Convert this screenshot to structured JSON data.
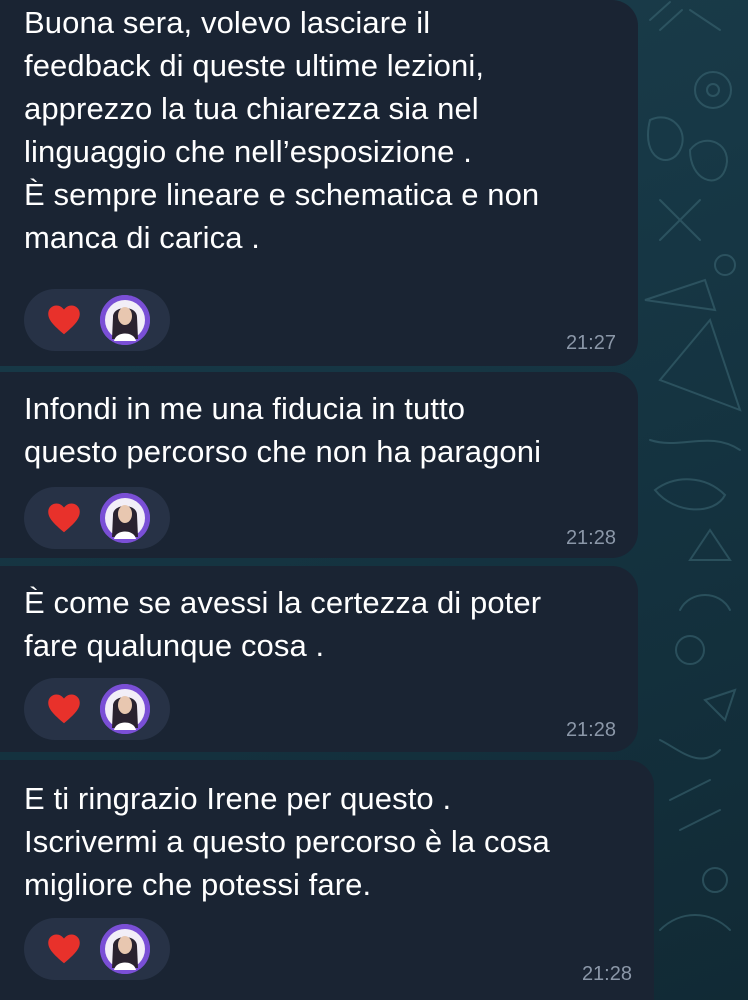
{
  "messages": [
    {
      "text": "Buona sera, volevo lasciare il\nfeedback di queste ultime lezioni,\napprezzo la tua chiarezza sia nel\nlinguaggio che nell’esposizione .\nÈ sempre lineare e schematica e non\nmanca di carica .",
      "time": "21:27",
      "reaction": "heart-icon"
    },
    {
      "text": "Infondi in me una fiducia in tutto\nquesto percorso che non ha paragoni",
      "time": "21:28",
      "reaction": "heart-icon"
    },
    {
      "text": "È come se avessi la certezza di poter\nfare qualunque cosa .",
      "time": "21:28",
      "reaction": "heart-icon"
    },
    {
      "text": "E ti ringrazio Irene per questo .\nIscrivermi a questo percorso è la cosa\nmigliore che potessi fare.",
      "time": "21:28",
      "reaction": "heart-icon"
    }
  ],
  "colors": {
    "background": "#173846",
    "bubble": "#1a2433",
    "reaction_pill": "#273246",
    "heart": "#e8312b",
    "timestamp": "#8b97a8",
    "text": "#ffffff",
    "avatar_ring": "#7a4fd6"
  }
}
